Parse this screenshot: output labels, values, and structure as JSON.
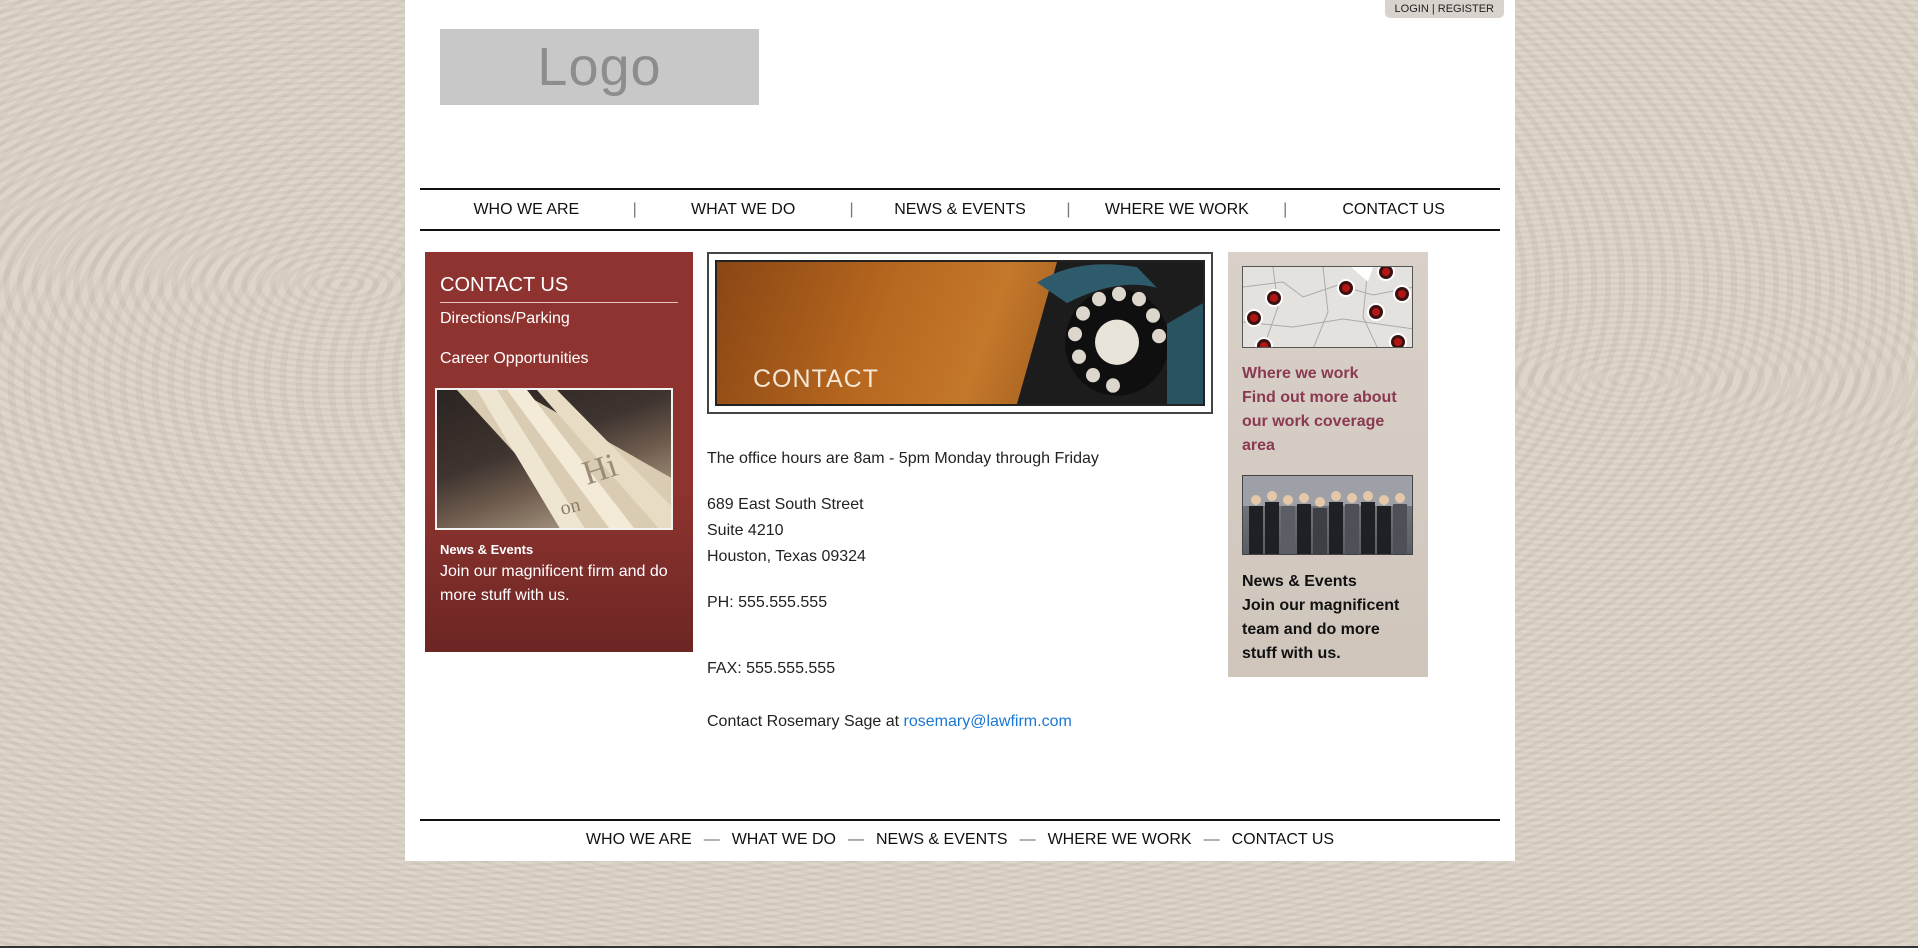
{
  "header": {
    "login": "LOGIN",
    "login_separator": " | ",
    "register": "REGISTER",
    "logo_text": "Logo"
  },
  "nav": {
    "items": [
      "WHO WE ARE",
      "WHAT WE DO",
      "NEWS & EVENTS",
      "WHERE WE WORK",
      "CONTACT US"
    ],
    "separator": "|"
  },
  "sidebar_left": {
    "title": "CONTACT US",
    "links": [
      "Directions/Parking",
      "Career Opportunities"
    ],
    "news_title": "News & Events",
    "news_text": "Join our magnificent firm and do more stuff with us."
  },
  "banner": {
    "label": "CONTACT"
  },
  "main": {
    "hours": "The office hours are 8am - 5pm Monday through Friday",
    "address": [
      "689 East South Street",
      "Suite 4210",
      "Houston, Texas 09324"
    ],
    "phone": "PH: 555.555.555",
    "fax": "FAX: 555.555.555",
    "contact_prefix": "Contact Rosemary Sage at ",
    "contact_email": "rosemary@lawfirm.com"
  },
  "sidebar_right": {
    "heading_lines": [
      "Where we work",
      "Find out more about our work coverage area"
    ],
    "news_title": "News & Events",
    "news_text": "Join our magnificent team and do more stuff with us."
  },
  "footer": {
    "items": [
      "WHO WE ARE",
      "WHAT WE DO",
      "NEWS & EVENTS",
      "WHERE WE WORK",
      "CONTACT US"
    ],
    "separator": "—"
  },
  "colors": {
    "left_panel": "#8e332f",
    "right_panel": "#d9d1c9",
    "right_heading": "#8a3952",
    "link": "#1a77d3"
  },
  "icons": {
    "map_marker": "map-marker-icon"
  }
}
